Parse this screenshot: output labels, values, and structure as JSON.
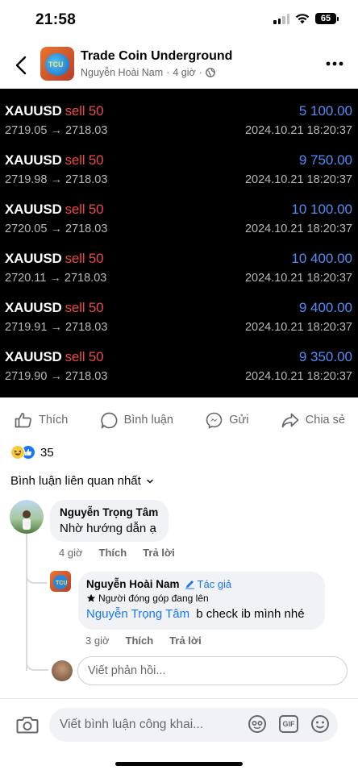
{
  "status_bar": {
    "time": "21:58",
    "battery": "65"
  },
  "header": {
    "group_name": "Trade Coin Underground",
    "author": "Nguyễn Hoài Nam",
    "time_ago": "4 giờ",
    "separator": "·",
    "privacy_icon": "globe-icon",
    "back_icon": "chevron-left-icon",
    "more_icon": "more-dots-icon"
  },
  "trades": [
    {
      "symbol": "XAUUSD",
      "side": "sell 50",
      "profit": "5 100.00",
      "open_price": "2719.05",
      "arrow": "→",
      "close_price": "2718.03",
      "datetime": "2024.10.21 18:20:37"
    },
    {
      "symbol": "XAUUSD",
      "side": "sell 50",
      "profit": "9 750.00",
      "open_price": "2719.98",
      "arrow": "→",
      "close_price": "2718.03",
      "datetime": "2024.10.21 18:20:37"
    },
    {
      "symbol": "XAUUSD",
      "side": "sell 50",
      "profit": "10 100.00",
      "open_price": "2720.05",
      "arrow": "→",
      "close_price": "2718.03",
      "datetime": "2024.10.21 18:20:37"
    },
    {
      "symbol": "XAUUSD",
      "side": "sell 50",
      "profit": "10 400.00",
      "open_price": "2720.11",
      "arrow": "→",
      "close_price": "2718.03",
      "datetime": "2024.10.21 18:20:37"
    },
    {
      "symbol": "XAUUSD",
      "side": "sell 50",
      "profit": "9 400.00",
      "open_price": "2719.91",
      "arrow": "→",
      "close_price": "2718.03",
      "datetime": "2024.10.21 18:20:37"
    },
    {
      "symbol": "XAUUSD",
      "side": "sell 50",
      "profit": "9 350.00",
      "open_price": "2719.90",
      "arrow": "→",
      "close_price": "2718.03",
      "datetime": "2024.10.21 18:20:37"
    }
  ],
  "actions": {
    "like": "Thích",
    "comment": "Bình luận",
    "send": "Gửi",
    "share": "Chia sẻ"
  },
  "reactions": {
    "count": "35",
    "types": [
      "haha-icon",
      "like-icon"
    ]
  },
  "comments_sort": {
    "label": "Bình luận liên quan nhất",
    "icon": "chevron-down-icon"
  },
  "comments": [
    {
      "author": "Nguyễn Trọng Tâm",
      "text": "Nhờ hướng dẫn ạ",
      "time": "4 giờ",
      "like": "Thích",
      "reply": "Trả lời"
    }
  ],
  "reply": {
    "author": "Nguyễn Hoài Nam",
    "author_badge": "Tác giả",
    "contributor_badge": "Người đóng góp đang lên",
    "mention": "Nguyễn Trọng Tâm",
    "text": "b check ib mình nhé",
    "time": "3 giờ",
    "like": "Thích",
    "reply": "Trả lời"
  },
  "reply_input": {
    "placeholder": "Viết phản hồi..."
  },
  "composer": {
    "placeholder": "Viết bình luận công khai...",
    "gif_label": "GIF"
  },
  "colors": {
    "sell": "#e94a4a",
    "profit": "#4f8ff7",
    "link": "#1877f2",
    "secondary_text": "#65676b"
  }
}
